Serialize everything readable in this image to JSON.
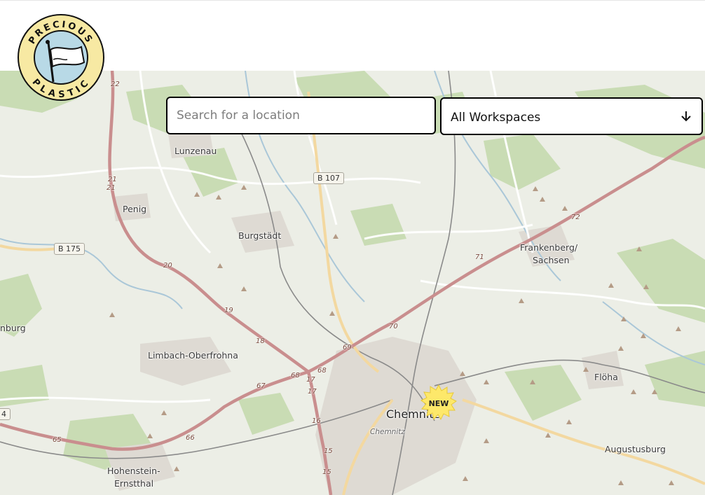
{
  "logo": {
    "top_text": "PRECIOUS",
    "bottom_text": "PLASTIC",
    "icon": "flag-hand-icon"
  },
  "search": {
    "placeholder": "Search for a location",
    "value": ""
  },
  "filter": {
    "selected": "All Workspaces",
    "icon": "arrow-down-icon"
  },
  "map": {
    "places": [
      "Lunzenau",
      "Penig",
      "Burgstädt",
      "Frankenberg/",
      "Sachsen",
      "Limbach-Oberfrohna",
      "Chemnitz",
      "Flöha",
      "Augustusburg",
      "Hohenstein-",
      "Ernstthal",
      "nburg"
    ],
    "district_label": "Chemnitz",
    "road_shields": [
      "B 107",
      "B 175",
      "4"
    ],
    "road_numbers": [
      "22",
      "21",
      "21",
      "20",
      "19",
      "18",
      "67",
      "68",
      "17",
      "17",
      "16",
      "15",
      "15",
      "65",
      "66",
      "68",
      "69",
      "70",
      "71",
      "72"
    ],
    "marker": {
      "label": "NEW",
      "icon": "new-workspace-marker-icon"
    },
    "colors": {
      "land": "#eceee6",
      "forest": "#c9dcb4",
      "urban": "#dedad3",
      "motorway": "#c98e8e"
    }
  }
}
